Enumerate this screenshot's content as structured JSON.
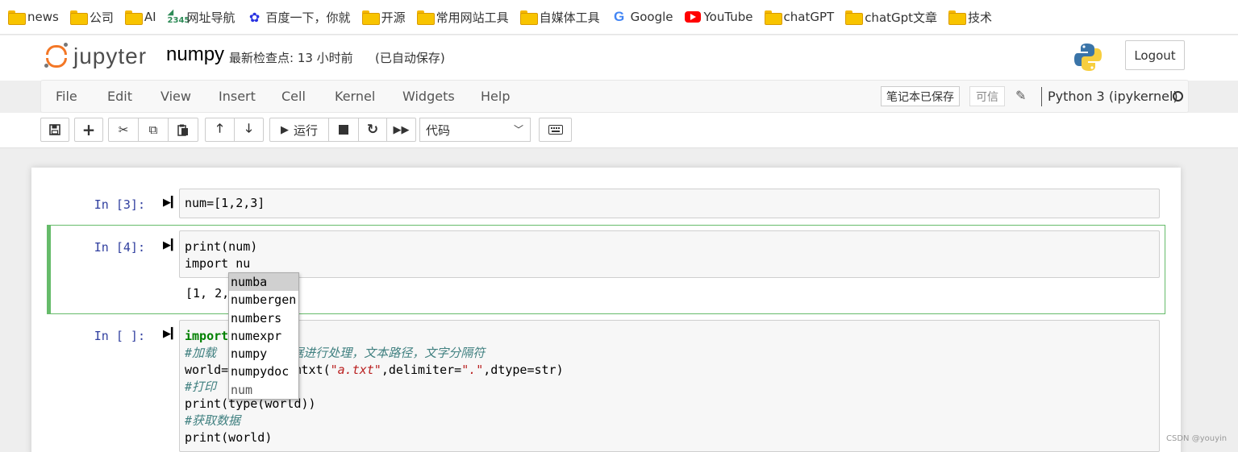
{
  "bookmarks": [
    {
      "label": "news",
      "icon": "folder-icon"
    },
    {
      "label": "公司",
      "icon": "folder-icon"
    },
    {
      "label": "AI",
      "icon": "folder-icon"
    },
    {
      "label": "网址导航",
      "icon": "nav-2345-icon"
    },
    {
      "label": "百度一下，你就",
      "icon": "baidu-paw-icon"
    },
    {
      "label": "开源",
      "icon": "folder-icon"
    },
    {
      "label": "常用网站工具",
      "icon": "folder-icon"
    },
    {
      "label": "自媒体工具",
      "icon": "folder-icon"
    },
    {
      "label": "Google",
      "icon": "google-icon"
    },
    {
      "label": "YouTube",
      "icon": "youtube-icon"
    },
    {
      "label": "chatGPT",
      "icon": "folder-icon"
    },
    {
      "label": "chatGpt文章",
      "icon": "folder-icon"
    },
    {
      "label": "技术",
      "icon": "folder-icon"
    }
  ],
  "header": {
    "logo_text": "jupyter",
    "notebook_name": "numpy",
    "checkpoint": "最新检查点: 13 小时前",
    "autosave": "(已自动保存)",
    "logout": "Logout"
  },
  "menu": {
    "items": [
      "File",
      "Edit",
      "View",
      "Insert",
      "Cell",
      "Kernel",
      "Widgets",
      "Help"
    ],
    "not_saved": "笔记本已保存",
    "trusted": "可信",
    "kernel": "Python 3 (ipykernel)"
  },
  "toolbar": {
    "run_label": "运行",
    "cell_type": "代码"
  },
  "cells": [
    {
      "prompt": "In  [3]:",
      "code": "num=[1,2,3]"
    },
    {
      "prompt": "In  [4]:",
      "code_line1": "print(num)",
      "code_line2": "import nu",
      "output": "[1, 2,"
    },
    {
      "prompt": "In  [ ]:",
      "lines": [
        "import",
        "#加载",
        "world=",
        "#打印",
        "print(type(world))",
        "#获取数据",
        "print(world)"
      ],
      "comment1_rest": "对数据进行处理，文本路径，文字分隔符",
      "line3_rest": "romtxt(",
      "line3_str1": "\"a.txt\"",
      "line3_mid": ",delimiter=",
      "line3_str2": "\".\"",
      "line3_end": ",dtype=str)"
    }
  ],
  "autocomplete": [
    "numba",
    "numbergen",
    "numbers",
    "numexpr",
    "numpy",
    "numpydoc",
    "num"
  ],
  "watermark": "CSDN @youyin",
  "colors": {
    "accent_green": "#66bb6a",
    "prompt_blue": "#303f9f",
    "jupyter_orange": "#f37726"
  }
}
